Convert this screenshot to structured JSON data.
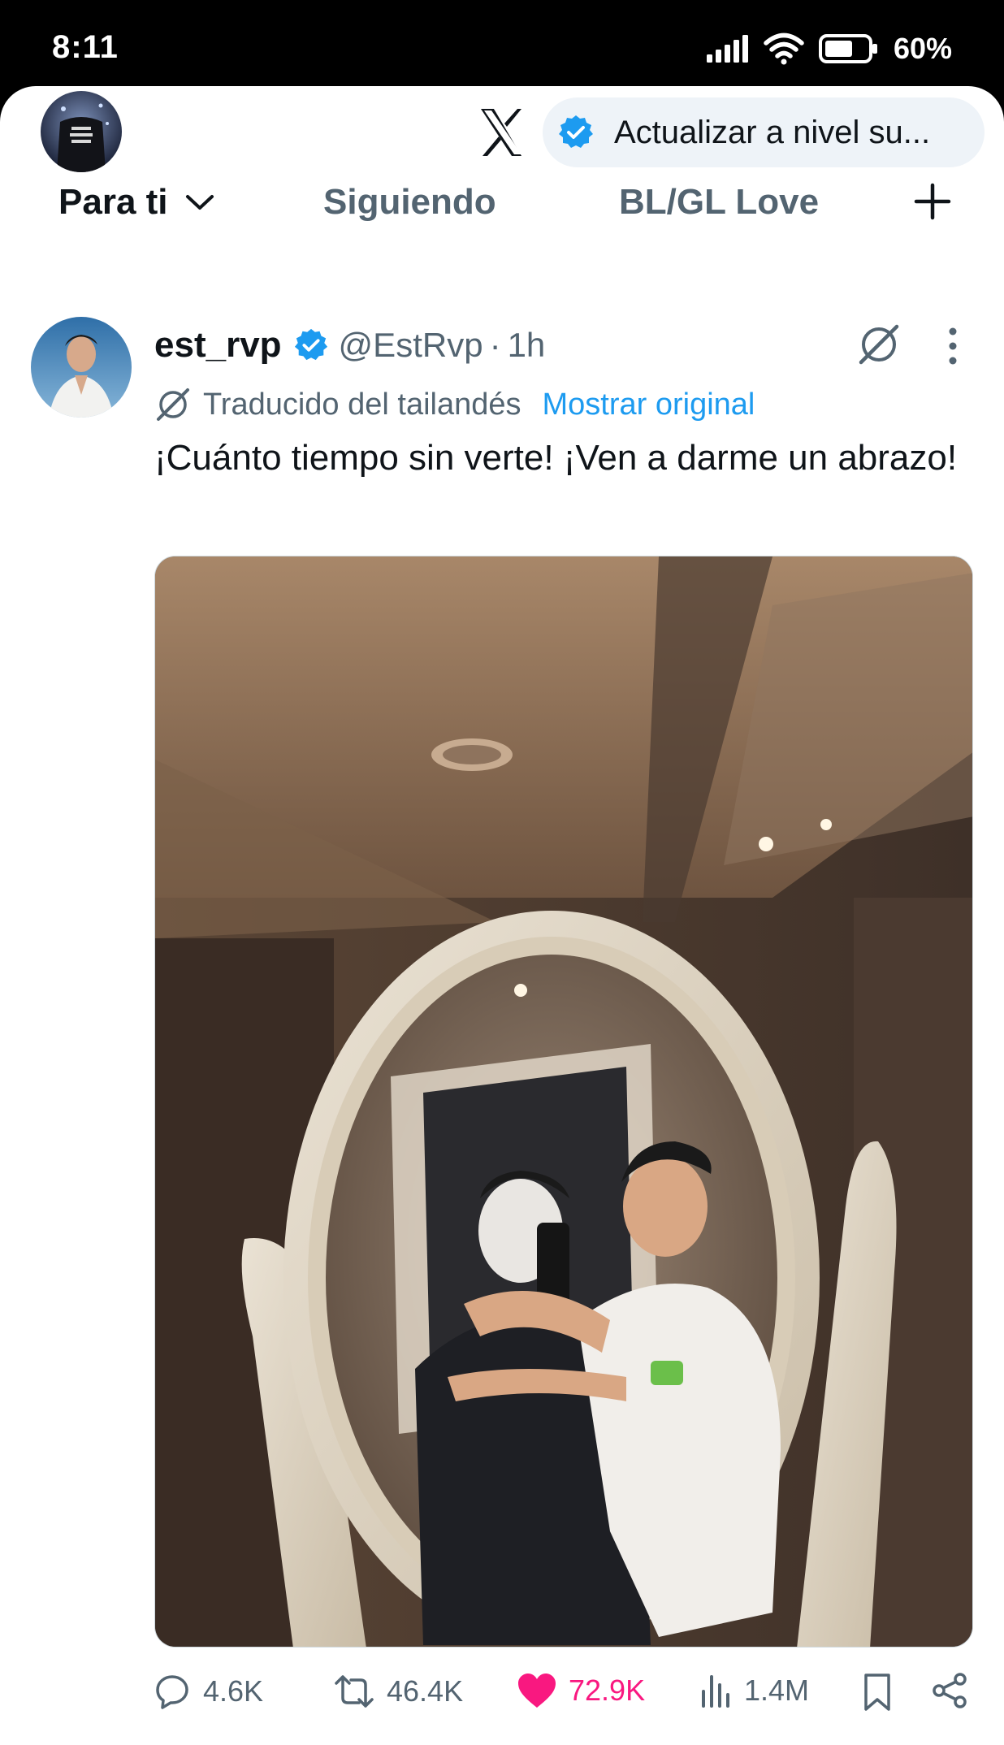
{
  "status_bar": {
    "time": "8:11",
    "battery": "60%",
    "icons": [
      "signal-icon",
      "wifi-icon",
      "battery-icon"
    ]
  },
  "top_bar": {
    "logo": "x-logo",
    "premium_label": "Actualizar a nivel su..."
  },
  "tabs": [
    {
      "label": "Para ti",
      "active": true
    },
    {
      "label": "Siguiendo",
      "active": false
    },
    {
      "label": "BL/GL Love",
      "active": false
    }
  ],
  "tweet": {
    "display_name": "est_rvp",
    "handle": "@EstRvp",
    "separator": "·",
    "time": "1h",
    "translated_label": "Traducido del tailandés",
    "show_original": "Mostrar original",
    "text": "¡Cuánto tiempo sin verte! ¡Ven a darme un abrazo!",
    "stats": {
      "replies": "4.6K",
      "reposts": "46.4K",
      "likes": "72.9K",
      "views": "1.4M"
    }
  },
  "colors": {
    "accent": "#1d9bf0",
    "like": "#f91880",
    "text": "#0f1419",
    "secondary": "#536471"
  }
}
